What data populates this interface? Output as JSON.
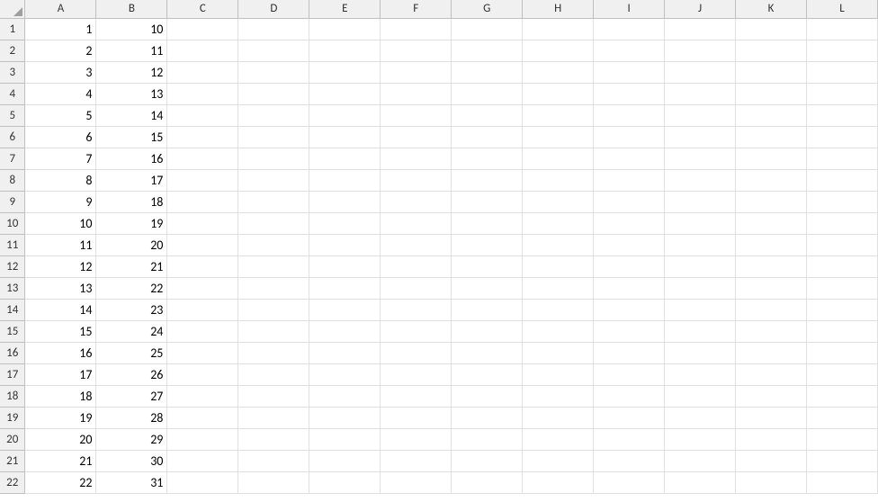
{
  "columns": [
    "A",
    "B",
    "C",
    "D",
    "E",
    "F",
    "G",
    "H",
    "I",
    "J",
    "K",
    "L"
  ],
  "rowCount": 22,
  "cells": {
    "A": [
      1,
      2,
      3,
      4,
      5,
      6,
      7,
      8,
      9,
      10,
      11,
      12,
      13,
      14,
      15,
      16,
      17,
      18,
      19,
      20,
      21,
      22
    ],
    "B": [
      10,
      11,
      12,
      13,
      14,
      15,
      16,
      17,
      18,
      19,
      20,
      21,
      22,
      23,
      24,
      25,
      26,
      27,
      28,
      29,
      30,
      31
    ]
  }
}
